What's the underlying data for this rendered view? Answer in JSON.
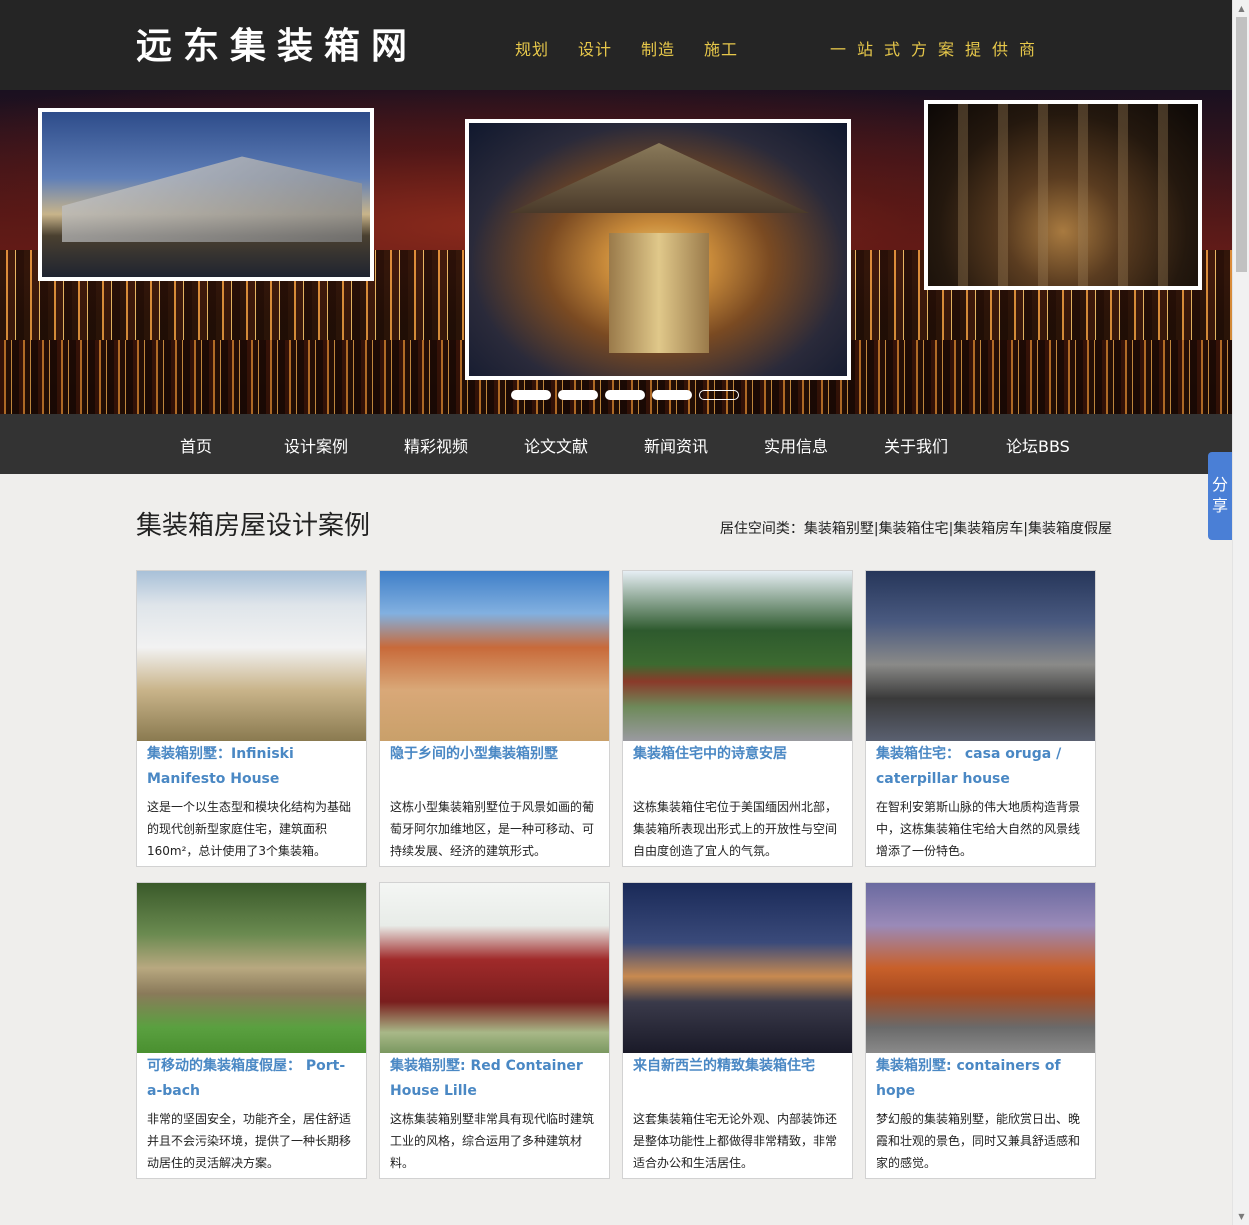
{
  "header": {
    "logo": "远东集装箱网",
    "nav": [
      "规划",
      "设计",
      "制造",
      "施工"
    ],
    "slogan": "一站式方案提供商"
  },
  "banner": {
    "slide_count": 5,
    "active_slide": 5
  },
  "main_nav": [
    "首页",
    "设计案例",
    "精彩视频",
    "论文文献",
    "新闻资讯",
    "实用信息",
    "关于我们",
    "论坛BBS"
  ],
  "section": {
    "title": "集装箱房屋设计案例",
    "category_label": "居住空间类：",
    "categories": [
      "集装箱别墅",
      "集装箱住宅",
      "集装箱房车",
      "集装箱度假屋"
    ],
    "separator": "|"
  },
  "cards": [
    {
      "title": "集装箱别墅：Infiniski Manifesto House",
      "desc": "这是一个以生态型和模块化结构为基础的现代创新型家庭住宅，建筑面积160m²，总计使用了3个集装箱。"
    },
    {
      "title": "隐于乡间的小型集装箱别墅",
      "desc": "这栋小型集装箱别墅位于风景如画的葡萄牙阿尔加维地区，是一种可移动、可持续发展、经济的建筑形式。"
    },
    {
      "title": "集装箱住宅中的诗意安居",
      "desc": "这栋集装箱住宅位于美国缅因州北部，集装箱所表现出形式上的开放性与空间自由度创造了宜人的气氛。"
    },
    {
      "title": "集装箱住宅： casa oruga / caterpillar house",
      "desc": "在智利安第斯山脉的伟大地质构造背景中，这栋集装箱住宅给大自然的风景线增添了一份特色。"
    },
    {
      "title": "可移动的集装箱度假屋： Port-a-bach",
      "desc": "非常的坚固安全，功能齐全，居住舒适并且不会污染环境，提供了一种长期移动居住的灵活解决方案。"
    },
    {
      "title": "集装箱别墅: Red Container House Lille",
      "desc": "这栋集装箱别墅非常具有现代临时建筑工业的风格，综合运用了多种建筑材料。"
    },
    {
      "title": "来自新西兰的精致集装箱住宅",
      "desc": "这套集装箱住宅无论外观、内部装饰还是整体功能性上都做得非常精致，非常适合办公和生活居住。"
    },
    {
      "title": "集装箱别墅: containers of hope",
      "desc": "梦幻般的集装箱别墅，能欣赏日出、晚霞和壮观的景色，同时又兼具舒适感和家的感觉。"
    }
  ],
  "share": {
    "label": "分享"
  },
  "colors": {
    "header_bg": "#252525",
    "nav_bg": "#333333",
    "accent_yellow": "#e7c84a",
    "link_blue": "#4a88c4",
    "share_blue": "#4a7fd6",
    "page_bg": "#efeeec"
  }
}
